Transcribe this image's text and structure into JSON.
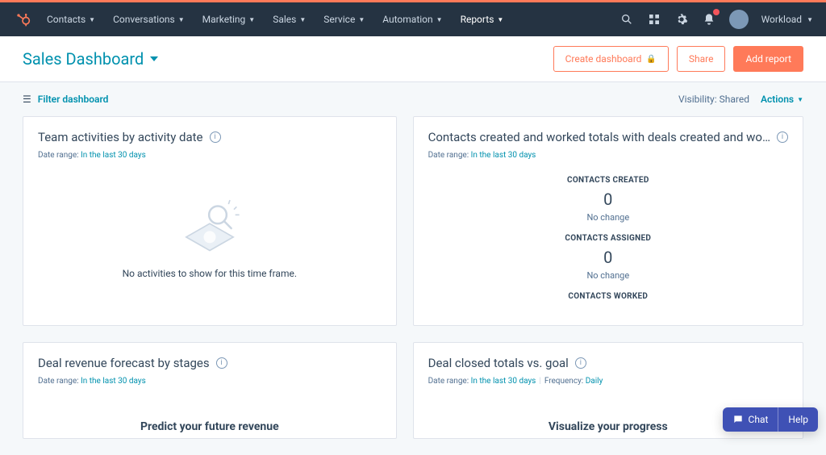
{
  "nav": {
    "items": [
      {
        "label": "Contacts"
      },
      {
        "label": "Conversations"
      },
      {
        "label": "Marketing"
      },
      {
        "label": "Sales"
      },
      {
        "label": "Service"
      },
      {
        "label": "Automation"
      },
      {
        "label": "Reports"
      }
    ],
    "workload_label": "Workload"
  },
  "header": {
    "title": "Sales Dashboard",
    "create_dashboard": "Create dashboard",
    "share": "Share",
    "add_report": "Add report"
  },
  "subheader": {
    "filter_label": "Filter dashboard",
    "visibility_label": "Visibility:",
    "visibility_value": "Shared",
    "actions_label": "Actions"
  },
  "cards": {
    "range_prefix": "Date range:",
    "range_value": "In the last 30 days",
    "freq_prefix": "Frequency:",
    "freq_value": "Daily",
    "c1": {
      "title": "Team activities by activity date",
      "empty": "No activities to show for this time frame."
    },
    "c2": {
      "title": "Contacts created and worked totals with deals created and wo…",
      "m1_label": "CONTACTS CREATED",
      "m1_val": "0",
      "m1_change": "No change",
      "m2_label": "CONTACTS ASSIGNED",
      "m2_val": "0",
      "m2_change": "No change",
      "m3_label": "CONTACTS WORKED"
    },
    "c3": {
      "title": "Deal revenue forecast by stages",
      "big": "Predict your future revenue"
    },
    "c4": {
      "title": "Deal closed totals vs. goal",
      "big": "Visualize your progress"
    }
  },
  "help": {
    "chat": "Chat",
    "help": "Help"
  }
}
